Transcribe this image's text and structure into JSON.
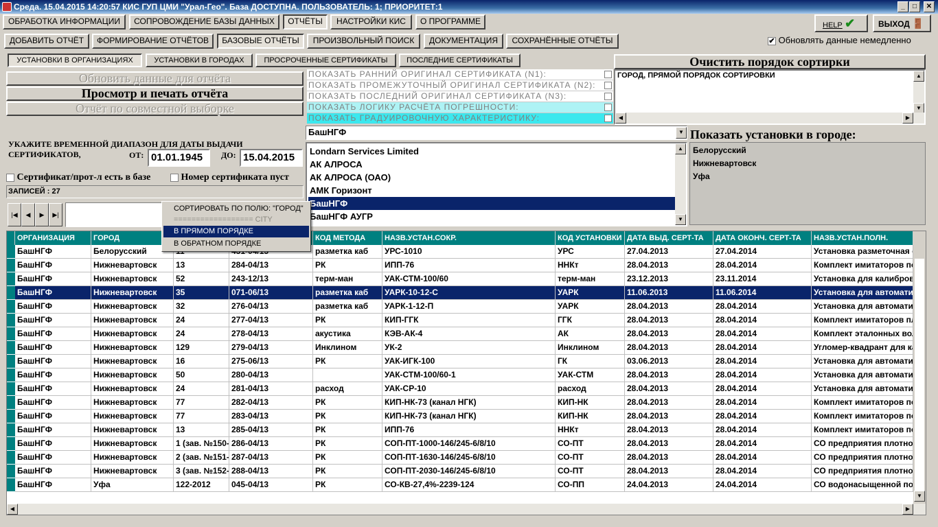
{
  "window": {
    "title": "Среда. 15.04.2015 14:20:57 КИС ГУП ЦМИ \"Урал-Гео\". База ДОСТУПНА. ПОЛЬЗОВАТЕЛЬ: 1; ПРИОРИТЕТ:1",
    "minimize": "_",
    "maximize": "□",
    "close": "✕"
  },
  "menu": [
    {
      "label": "ОБРАБОТКА ИНФОРМАЦИИ"
    },
    {
      "label": "СОПРОВОЖДЕНИЕ БАЗЫ ДАННЫХ"
    },
    {
      "label": "ОТЧЁТЫ"
    },
    {
      "label": "НАСТРОЙКИ КИС"
    },
    {
      "label": "О ПРОГРАММЕ"
    }
  ],
  "help_label": "HELP",
  "help_icon": "✔",
  "exit_label": "ВЫХОД",
  "exit_icon": "🚪",
  "subtabs": [
    {
      "label": "ДОБАВИТЬ ОТЧЁТ"
    },
    {
      "label": "ФОРМИРОВАНИЕ ОТЧЁТОВ"
    },
    {
      "label": "БАЗОВЫЕ ОТЧЁТЫ"
    },
    {
      "label": "ПРОИЗВОЛЬНЫЙ ПОИСК"
    },
    {
      "label": "ДОКУМЕНТАЦИЯ"
    },
    {
      "label": "СОХРАНЁННЫЕ ОТЧЁТЫ"
    }
  ],
  "auto_update_label": "Обновлять данные немедленно",
  "auto_update_check": "✔",
  "reporttabs": [
    {
      "label": "УСТАНОВКИ В ОРГАНИЗАЦИЯХ"
    },
    {
      "label": "УСТАНОВКИ В ГОРОДАХ"
    },
    {
      "label": "ПРОСРОЧЕННЫЕ СЕРТИФИКАТЫ"
    },
    {
      "label": "ПОСЛЕДНИЕ СЕРТИФИКАТЫ"
    }
  ],
  "clear_sort_label": "Очистить порядок сортирки",
  "sort_order_text": "ГОРОД, ПРЯМОЙ ПОРЯДОК СОРТИРОВКИ",
  "big_buttons": {
    "refresh": "Обновить данные для отчёта",
    "preview": "Просмотр и печать отчёта",
    "joint": "Отчёт по совместной выборке"
  },
  "options": [
    {
      "label": "ПОКАЗАТЬ РАННИЙ ОРИГИНАЛ СЕРТИФИКАТА (N1):"
    },
    {
      "label": "ПОКАЗАТЬ ПРОМЕЖУТОЧНЫЙ ОРИГИНАЛ СЕРТИФИКАТА (N2):"
    },
    {
      "label": "ПОКАЗАТЬ ПОСЛЕДНИЙ ОРИГИНАЛ СЕРТИФИКАТА (N3):"
    },
    {
      "label": "ПОКАЗАТЬ ЛОГИКУ РАСЧЁТА ПОГРЕШНОСТИ:"
    },
    {
      "label": "ПОКАЗАТЬ ГРАДУИРОВОЧНУЮ ХАРАКТЕРИСТИКУ:"
    }
  ],
  "org_combo_value": "БашНГФ",
  "orgs": [
    "Londarn Services Limited",
    "АК АЛРОСА",
    "АК АЛРОСА (ОАО)",
    "АМК Горизонт",
    "БашНГФ",
    "БашНГФ АУГР"
  ],
  "cities_title": "Показать установки в городе:",
  "cities": [
    "Белорусский",
    "Нижневартовск",
    "Уфа"
  ],
  "date_range": {
    "label": "УКАЖИТЕ ВРЕМЕННОЙ ДИАПАЗОН ДЛЯ ДАТЫ ВЫДАЧИ СЕРТИФИКАТОВ,",
    "from_label": "ОТ:",
    "from": "01.01.1945",
    "to_label": "ДО:",
    "to": "15.04.2015"
  },
  "filter_cert_label": "Сертификат/прот-л есть в базе",
  "filter_number_label": "Номер сертификата пуст",
  "records_label": "ЗАПИСЕЙ : 27",
  "nav": {
    "first": "|◀",
    "prev": "◀",
    "next": "▶",
    "last": "▶|"
  },
  "context_menu": {
    "sort_by": "СОРТИРОВАТЬ ПО ПОЛЮ: \"ГОРОД\"",
    "separator": "================== CITY",
    "asc": "В ПРЯМОМ ПОРЯДКЕ",
    "desc": "В ОБРАТНОМ ПОРЯДКЕ"
  },
  "columns": [
    "ОРГАНИЗАЦИЯ",
    "ГОРОД",
    "",
    "",
    "КОД МЕТОДА",
    "НАЗВ.УСТАН.СОКР.",
    "КОД УСТАНОВКИ",
    "ДАТА ВЫД. СЕРТ-ТА",
    "ДАТА ОКОНЧ. СЕРТ-ТА",
    "НАЗВ.УСТАН.ПОЛН."
  ],
  "rows": [
    [
      "БашНГФ",
      "Белорусский",
      "11",
      "431-04/13",
      "разметка каб",
      "УРС-1010",
      "УРС",
      "27.04.2013",
      "27.04.2014",
      "Установка разметочная с"
    ],
    [
      "БашНГФ",
      "Нижневартовск",
      "13",
      "284-04/13",
      "РК",
      "ИПП-76",
      "ННКт",
      "28.04.2013",
      "28.04.2014",
      "Комплект имитаторов пор"
    ],
    [
      "БашНГФ",
      "Нижневартовск",
      "52",
      "243-12/13",
      "терм-ман",
      "УАК-СТМ-100/60",
      "терм-ман",
      "23.12.2013",
      "23.11.2014",
      "Установка для калибров"
    ],
    [
      "БашНГФ",
      "Нижневартовск",
      "35",
      "071-06/13",
      "разметка каб",
      "УАРК-10-12-С",
      "УАРК",
      "11.06.2013",
      "11.06.2014",
      "Установка для автоматиз"
    ],
    [
      "БашНГФ",
      "Нижневартовск",
      "32",
      "276-04/13",
      "разметка каб",
      "УАРК-1-12-П",
      "УАРК",
      "28.04.2013",
      "28.04.2014",
      "Установка для автоматиз"
    ],
    [
      "БашНГФ",
      "Нижневартовск",
      "24",
      "277-04/13",
      "РК",
      "КИП-ГГК",
      "ГГК",
      "28.04.2013",
      "28.04.2014",
      "Комплект имитаторов пло"
    ],
    [
      "БашНГФ",
      "Нижневартовск",
      "24",
      "278-04/13",
      "акустика",
      "КЭВ-АК-4",
      "АК",
      "28.04.2013",
      "28.04.2014",
      "Комплект эталонных вол"
    ],
    [
      "БашНГФ",
      "Нижневартовск",
      "129",
      "279-04/13",
      "Инклином",
      "УК-2",
      "Инклином",
      "28.04.2013",
      "28.04.2014",
      "Угломер-квадрант для ка"
    ],
    [
      "БашНГФ",
      "Нижневартовск",
      "16",
      "275-06/13",
      "РК",
      "УАК-ИГК-100",
      "ГК",
      "03.06.2013",
      "28.04.2014",
      "Установка для автоматиз"
    ],
    [
      "БашНГФ",
      "Нижневартовск",
      "50",
      "280-04/13",
      "",
      "УАК-СТМ-100/60-1",
      "УАК-СТМ",
      "28.04.2013",
      "28.04.2014",
      "Установка для автоматиз"
    ],
    [
      "БашНГФ",
      "Нижневартовск",
      "24",
      "281-04/13",
      "расход",
      "УАК-СР-10",
      "расход",
      "28.04.2013",
      "28.04.2014",
      "Установка для автоматиз"
    ],
    [
      "БашНГФ",
      "Нижневартовск",
      "77",
      "282-04/13",
      "РК",
      "КИП-НК-73 (канал НГК)",
      "КИП-НК",
      "28.04.2013",
      "28.04.2014",
      "Комплект имитаторов пор"
    ],
    [
      "БашНГФ",
      "Нижневартовск",
      "77",
      "283-04/13",
      "РК",
      "КИП-НК-73 (канал НГК)",
      "КИП-НК",
      "28.04.2013",
      "28.04.2014",
      "Комплект имитаторов пор"
    ],
    [
      "БашНГФ",
      "Нижневартовск",
      "13",
      "285-04/13",
      "РК",
      "ИПП-76",
      "ННКт",
      "28.04.2013",
      "28.04.2014",
      "Комплект имитаторов пор"
    ],
    [
      "БашНГФ",
      "Нижневартовск",
      "1 (зав. №150-",
      "286-04/13",
      "РК",
      "СОП-ПТ-1000-146/245-6/8/10",
      "СО-ПТ",
      "28.04.2013",
      "28.04.2014",
      "СО предприятия плотнос"
    ],
    [
      "БашНГФ",
      "Нижневартовск",
      "2 (зав. №151-",
      "287-04/13",
      "РК",
      "СОП-ПТ-1630-146/245-6/8/10",
      "СО-ПТ",
      "28.04.2013",
      "28.04.2014",
      "СО предприятия плотнос"
    ],
    [
      "БашНГФ",
      "Нижневартовск",
      "3 (зав. №152-",
      "288-04/13",
      "РК",
      "СОП-ПТ-2030-146/245-6/8/10",
      "СО-ПТ",
      "28.04.2013",
      "28.04.2014",
      "СО предприятия плотнос"
    ],
    [
      "БашНГФ",
      "Уфа",
      "122-2012",
      "045-04/13",
      "РК",
      "СО-КВ-27,4%-2239-124",
      "СО-ПП",
      "24.04.2013",
      "24.04.2014",
      "СО водонасыщенной пор"
    ]
  ],
  "colors": {
    "accent": "#0a246a",
    "header": "#008080",
    "option_highlight": "#8ff3f7"
  }
}
